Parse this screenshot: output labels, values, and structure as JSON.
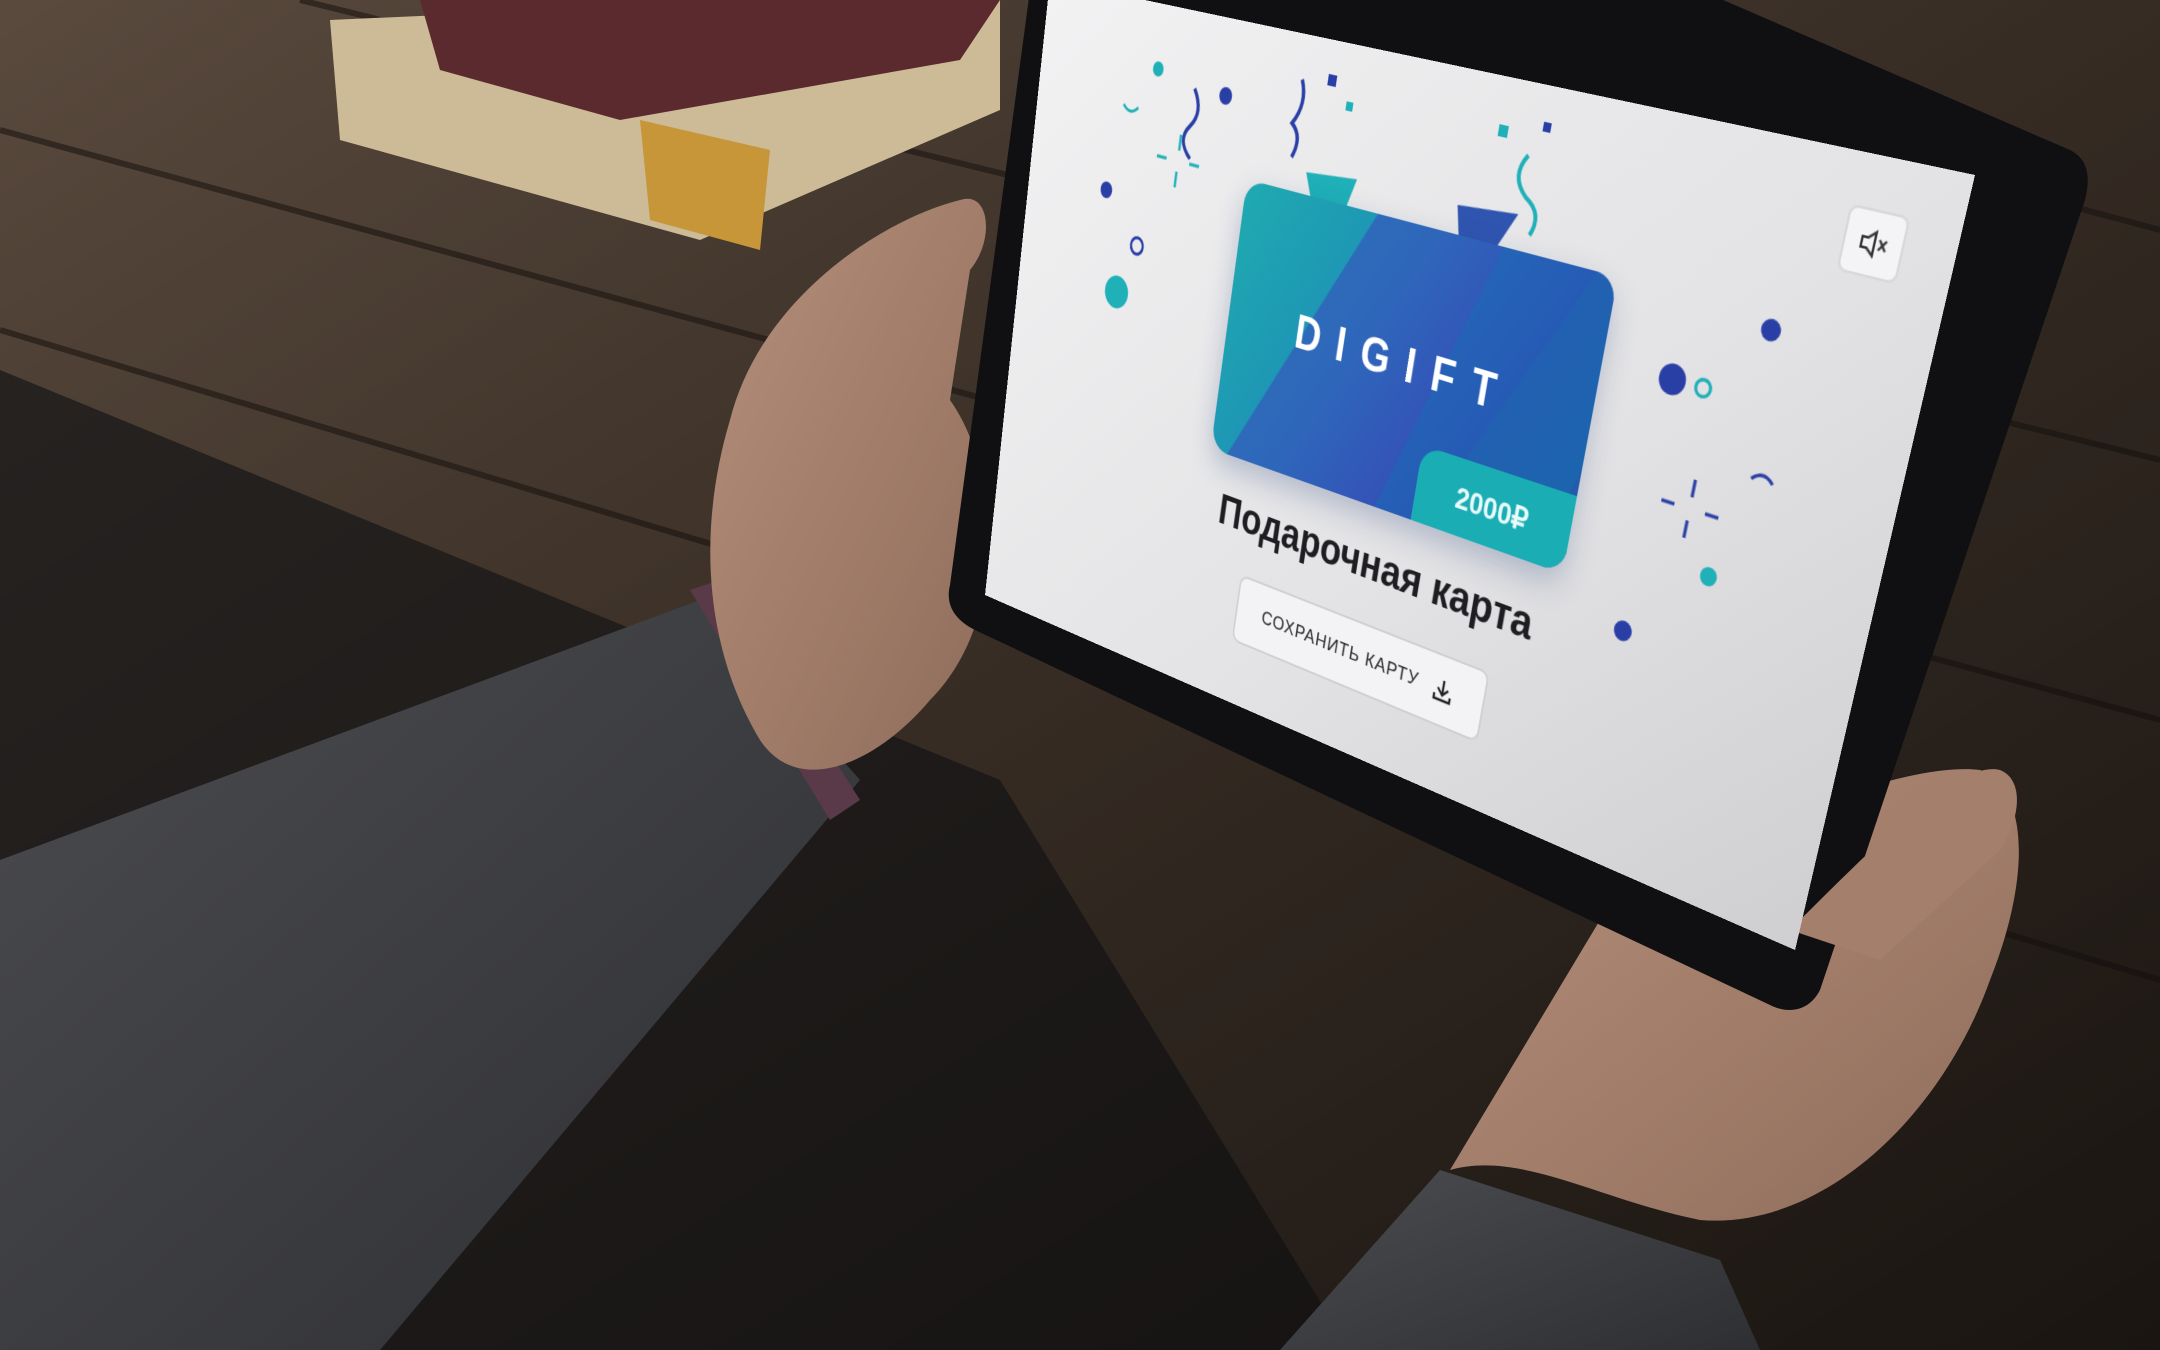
{
  "scene": {
    "description_icons": [
      "party-popper-icon",
      "mute-icon",
      "download-icon"
    ],
    "colors": {
      "teal": "#1faab0",
      "blue": "#2f55b0",
      "navy": "#2a3fa6",
      "table_wood": "#3a2e25",
      "sleeve": "#3b3c40"
    }
  },
  "screen": {
    "card": {
      "brand": "DIGIFT",
      "amount": "2000₽"
    },
    "title": "Подарочная карта",
    "save_button_label": "СОХРАНИТЬ КАРТУ"
  }
}
